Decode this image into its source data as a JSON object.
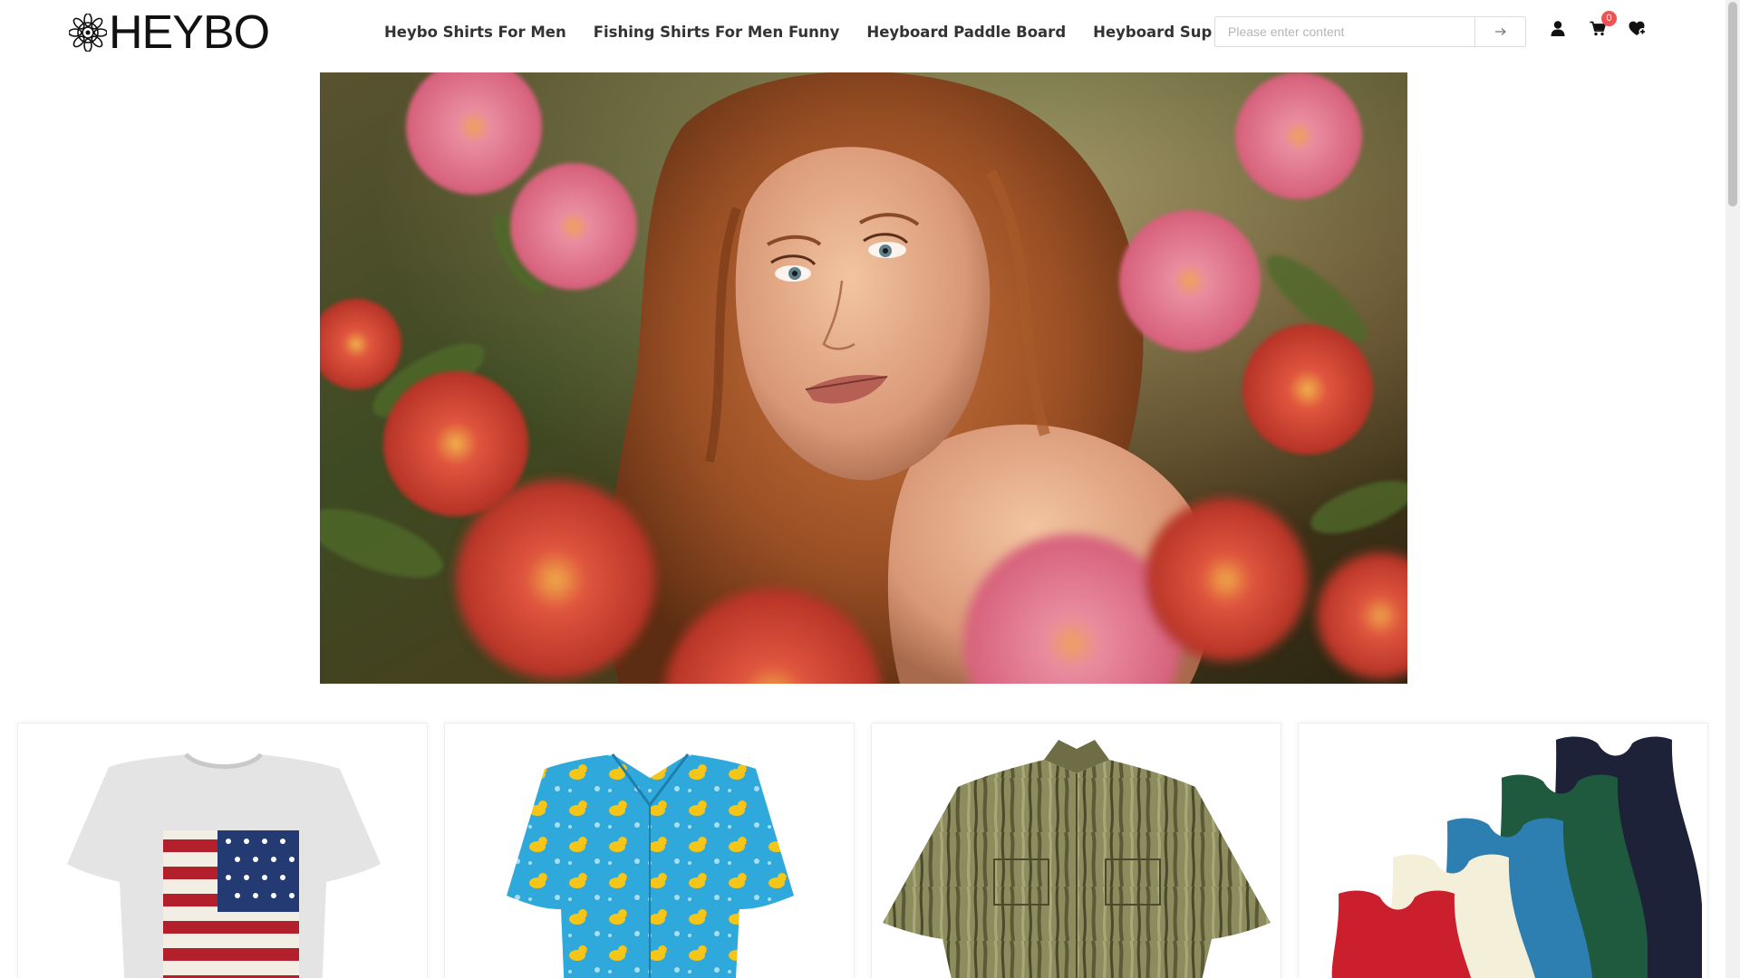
{
  "brand": {
    "name": "HEYBO"
  },
  "nav": {
    "items": [
      {
        "label": "Heybo Shirts For Men"
      },
      {
        "label": "Fishing Shirts For Men Funny"
      },
      {
        "label": "Heyboard Paddle Board"
      },
      {
        "label": "Heyboard Sup"
      }
    ]
  },
  "search": {
    "placeholder": "Please enter content",
    "value": "",
    "button_icon": "arrow-right-icon"
  },
  "header_icons": {
    "account": "user-icon",
    "cart": "cart-icon",
    "cart_count": "0",
    "wishlist": "heart-plus-icon"
  },
  "hero": {
    "image": "woman-with-flowers-banner"
  },
  "products": [
    {
      "image": "american-flag-tshirt"
    },
    {
      "image": "rubber-duck-hawaiian-shirt"
    },
    {
      "image": "camo-fishing-shirt"
    },
    {
      "image": "tank-tops-multipack"
    }
  ],
  "colors": {
    "badge": "#f05252",
    "nav_text": "#333333"
  }
}
